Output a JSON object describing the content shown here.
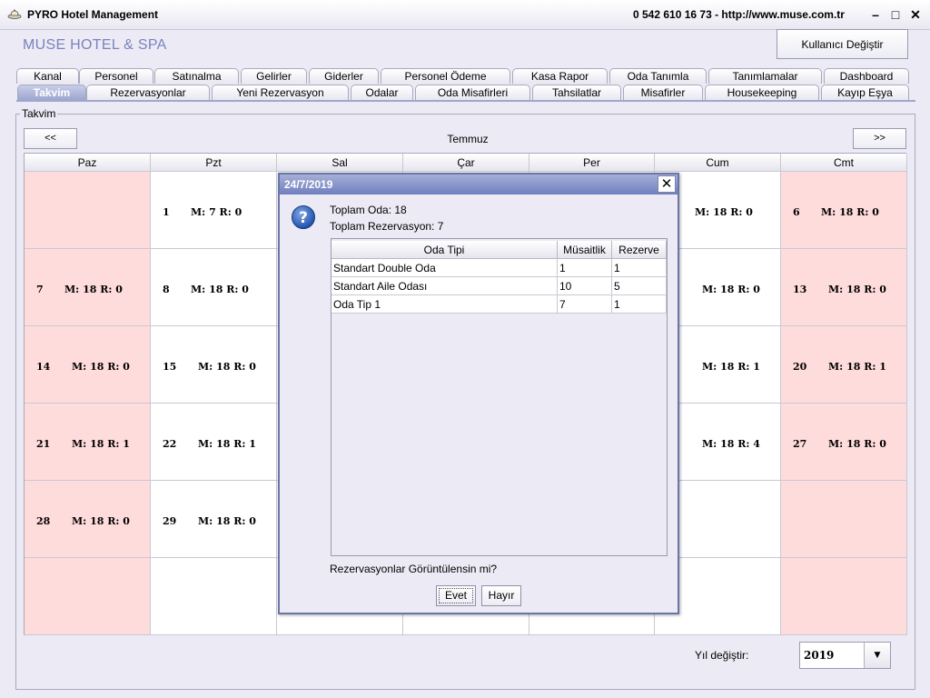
{
  "window": {
    "title": "PYRO Hotel Management",
    "contact": "0 542 610 16 73  -  http://www.muse.com.tr",
    "controls": {
      "minimize": "–",
      "maximize": "□",
      "close": "✕"
    }
  },
  "header": {
    "hotel_name": "MUSE HOTEL & SPA",
    "user_change": "Kullanıcı Değiştir"
  },
  "tabs_top": [
    "Kanal",
    "Personel",
    "Satınalma",
    "Gelirler",
    "Giderler",
    "Personel Ödeme",
    "Kasa Rapor",
    "Oda Tanımla",
    "Tanımlamalar",
    "Dashboard"
  ],
  "tabs_bottom": [
    "Takvim",
    "Rezervasyonlar",
    "Yeni Rezervasyon",
    "Odalar",
    "Oda Misafirleri",
    "Tahsilatlar",
    "Misafirler",
    "Housekeeping",
    "Kayıp Eşya"
  ],
  "active_tab": "Takvim",
  "calendar": {
    "group_label": "Takvim",
    "prev": "<<",
    "next": ">>",
    "month": "Temmuz",
    "days": [
      "Paz",
      "Pzt",
      "Sal",
      "Çar",
      "Per",
      "Cum",
      "Cmt"
    ],
    "cells": [
      [
        "",
        "1",
        "",
        "",
        "",
        "",
        "6"
      ],
      [
        "7",
        "8",
        "",
        "",
        "",
        "",
        "13"
      ],
      [
        "14",
        "15",
        "",
        "",
        "",
        "",
        "20"
      ],
      [
        "21",
        "22",
        "",
        "",
        "",
        "",
        "27"
      ],
      [
        "28",
        "29",
        "",
        "",
        "",
        "",
        ""
      ],
      [
        "",
        "",
        "",
        "",
        "",
        "",
        ""
      ]
    ],
    "stats": [
      [
        "",
        "M: 7 R: 0",
        "",
        "",
        "",
        "M: 18 R: 0",
        "M: 18 R: 0"
      ],
      [
        "M: 18 R: 0",
        "M: 18 R: 0",
        "",
        "",
        "",
        "M: 18 R: 0",
        "M: 18 R: 0"
      ],
      [
        "M: 18 R: 0",
        "M: 18 R: 0",
        "",
        "",
        "",
        "M: 18 R: 1",
        "M: 18 R: 1"
      ],
      [
        "M: 18 R: 1",
        "M: 18 R: 1",
        "",
        "",
        "",
        "M: 18 R: 4",
        "M: 18 R: 0"
      ],
      [
        "M: 18 R: 0",
        "M: 18 R: 0",
        "",
        "",
        "",
        "",
        ""
      ],
      [
        "",
        "",
        "",
        "",
        "",
        "",
        ""
      ]
    ]
  },
  "year": {
    "label": "Yıl değiştir:",
    "value": "2019"
  },
  "dialog": {
    "title": "24/7/2019",
    "total_rooms": "Toplam Oda:  18",
    "total_reservations": "Toplam Rezervasyon:  7",
    "columns": [
      "Oda Tipi",
      "Müsaitlik",
      "Rezerve"
    ],
    "rows": [
      [
        "Standart Double Oda",
        "1",
        "1"
      ],
      [
        "Standart Aile Odası",
        "10",
        "5"
      ],
      [
        "Oda Tip 1",
        "7",
        "1"
      ]
    ],
    "question": "Rezervasyonlar Görüntülensin mi?",
    "yes": "Evet",
    "no": "Hayır"
  }
}
